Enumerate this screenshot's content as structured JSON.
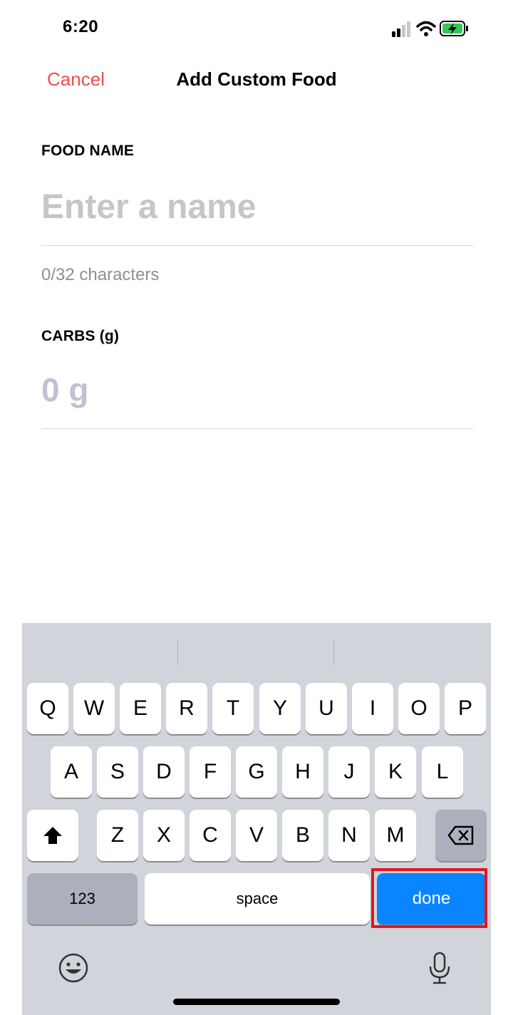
{
  "status": {
    "time": "6:20"
  },
  "nav": {
    "cancel_label": "Cancel",
    "title": "Add Custom Food"
  },
  "form": {
    "food_name_label": "FOOD NAME",
    "food_name_value": "",
    "food_name_placeholder": "Enter a name",
    "char_count": "0/32 characters",
    "carbs_label": "CARBS (g)",
    "carbs_value": "",
    "carbs_placeholder": "0 g"
  },
  "keyboard": {
    "row1": [
      "Q",
      "W",
      "E",
      "R",
      "T",
      "Y",
      "U",
      "I",
      "O",
      "P"
    ],
    "row2": [
      "A",
      "S",
      "D",
      "F",
      "G",
      "H",
      "J",
      "K",
      "L"
    ],
    "row3": [
      "Z",
      "X",
      "C",
      "V",
      "B",
      "N",
      "M"
    ],
    "numbers_label": "123",
    "space_label": "space",
    "done_label": "done"
  },
  "colors": {
    "accent_cancel": "#ee4f4f",
    "done_blue": "#0a84ff",
    "highlight_red": "#e0171f"
  }
}
